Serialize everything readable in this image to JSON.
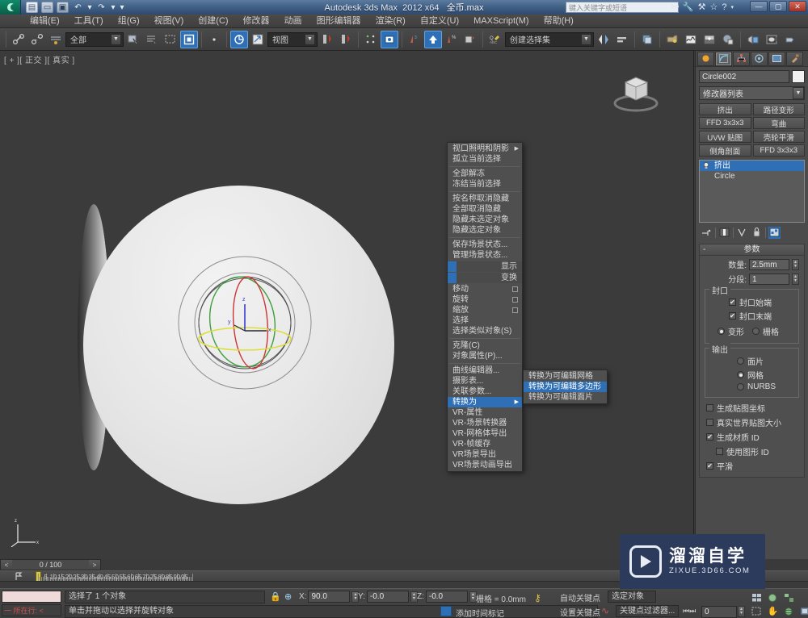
{
  "titlebar": {
    "app_name": "Autodesk 3ds Max",
    "version": "2012 x64",
    "file_name": "全币.max",
    "search_placeholder": "键入关键字或短语",
    "quick_access": [
      "new-icon",
      "open-icon",
      "save-icon",
      "undo-icon",
      "redo-icon",
      "customize-icon"
    ],
    "window_buttons": [
      "minimize",
      "maximize",
      "close"
    ]
  },
  "menubar": {
    "items": [
      {
        "label": "编辑(E)"
      },
      {
        "label": "工具(T)"
      },
      {
        "label": "组(G)"
      },
      {
        "label": "视图(V)"
      },
      {
        "label": "创建(C)"
      },
      {
        "label": "修改器"
      },
      {
        "label": "动画"
      },
      {
        "label": "图形编辑器"
      },
      {
        "label": "渲染(R)"
      },
      {
        "label": "自定义(U)"
      },
      {
        "label": "MAXScript(M)"
      },
      {
        "label": "帮助(H)"
      }
    ]
  },
  "toolbar": {
    "selection_filter": "全部",
    "reference_coord": "视图",
    "named_selection_set": "创建选择集",
    "buttons": [
      "link-icon",
      "unlink-icon",
      "bind-space-warp-icon",
      "select-object-icon",
      "select-by-name-icon",
      "select-region-icon",
      "window-crossing-icon",
      "select-and-move-icon",
      "select-and-rotate-icon",
      "select-and-scale-icon",
      "mirror-icon",
      "align-icon",
      "layers-icon",
      "curve-editor-icon",
      "schematic-view-icon",
      "material-editor-icon",
      "render-setup-icon",
      "rendered-frame-icon",
      "render-production-icon"
    ]
  },
  "viewport": {
    "label": "[ + ][ 正交 ][ 真实 ]",
    "axis_labels": {
      "x": "x",
      "y": "y",
      "z": "z"
    },
    "gizmo_colors": {
      "x_axis": "#cc3333",
      "y_axis": "#33aa33",
      "z_axis": "#dddd33",
      "screen": "#8d8d8d"
    },
    "object_color": "#e7e7e7"
  },
  "context_menu": {
    "items": [
      {
        "label": "视口照明和阴影",
        "submenu": true
      },
      {
        "label": "孤立当前选择"
      },
      {
        "divider_after": true
      },
      {
        "label": "全部解冻"
      },
      {
        "label": "冻结当前选择"
      },
      {
        "divider_after": true
      },
      {
        "label": "按名称取消隐藏"
      },
      {
        "label": "全部取消隐藏"
      },
      {
        "label": "隐藏未选定对象"
      },
      {
        "label": "隐藏选定对象"
      },
      {
        "divider_after": true
      },
      {
        "label": "保存场景状态..."
      },
      {
        "label": "管理场景状态..."
      }
    ],
    "right_rows": [
      {
        "label": "显示"
      },
      {
        "label": "变换"
      }
    ],
    "transform_items": [
      {
        "label": "移动",
        "settings_box": true
      },
      {
        "label": "旋转",
        "settings_box": true
      },
      {
        "label": "缩放",
        "settings_box": true
      },
      {
        "label": "选择"
      },
      {
        "label": "选择类似对象(S)"
      }
    ],
    "object_items": [
      {
        "label": "克隆(C)"
      },
      {
        "label": "对象属性(P)..."
      }
    ],
    "editor_items": [
      {
        "label": "曲线编辑器..."
      },
      {
        "label": "摄影表..."
      },
      {
        "label": "关联参数..."
      }
    ],
    "convert_item": {
      "label": "转换为",
      "submenu": true,
      "highlighted": true
    },
    "vray_items": [
      {
        "label": "VR-属性"
      },
      {
        "label": "VR-场景转换器"
      },
      {
        "label": "VR-网格体导出"
      },
      {
        "label": "VR-帧缓存"
      },
      {
        "label": "VR场景导出"
      },
      {
        "label": "VR场景动画导出"
      }
    ]
  },
  "submenu": {
    "items": [
      {
        "label": "转换为可编辑网格",
        "selected": false
      },
      {
        "label": "转换为可编辑多边形",
        "selected": true
      },
      {
        "label": "转换为可编辑面片",
        "selected": false
      }
    ]
  },
  "command_panel": {
    "tabs": [
      "create-tab",
      "modify-tab",
      "hierarchy-tab",
      "motion-tab",
      "display-tab",
      "utilities-tab"
    ],
    "active_tab_index": 1,
    "object_name": "Circle002",
    "modifier_list_label": "修改器列表",
    "modifier_buttons": [
      "挤出",
      "路径变形",
      "FFD 3x3x3",
      "弯曲",
      "UVW 贴图",
      "壳轮平滑",
      "侧角剖面",
      "FFD 3x3x3"
    ],
    "stack": [
      {
        "label": "挤出",
        "selected": true
      },
      {
        "label": "Circle",
        "selected": false
      }
    ],
    "stack_tools": [
      "pin-stack-icon",
      "show-end-result-icon",
      "make-unique-icon",
      "remove-modifier-icon",
      "configure-sets-icon"
    ],
    "parameters": {
      "title": "参数",
      "amount_label": "数量:",
      "amount_value": "2.5mm",
      "segments_label": "分段:",
      "segments_value": "1",
      "capping": {
        "group_label": "封口",
        "cap_start_label": "封口始端",
        "cap_start_checked": true,
        "cap_end_label": "封口末端",
        "cap_end_checked": true,
        "morph_label": "变形",
        "morph_selected": true,
        "grid_label": "栅格",
        "grid_selected": false
      },
      "output": {
        "group_label": "输出",
        "options": [
          {
            "label": "面片",
            "selected": false
          },
          {
            "label": "网格",
            "selected": true
          },
          {
            "label": "NURBS",
            "selected": false
          }
        ]
      },
      "gen_map_coords_label": "生成贴图坐标",
      "gen_map_coords_checked": false,
      "real_world_label": "真实世界贴图大小",
      "real_world_checked": false,
      "gen_material_id_label": "生成材质 ID",
      "gen_material_id_checked": true,
      "use_shape_id_label": "使用图形 ID",
      "use_shape_id_checked": false,
      "smooth_label": "平滑",
      "smooth_checked": true
    }
  },
  "timebar": {
    "current_frame_display": "0 / 100",
    "prev_label": "<",
    "next_label": ">",
    "tick_labels": [
      "5",
      "10",
      "15",
      "20",
      "25",
      "30",
      "35",
      "40",
      "45",
      "50",
      "55",
      "60",
      "65",
      "70",
      "75",
      "80",
      "85",
      "90",
      "95"
    ],
    "slider_frame": 0
  },
  "status": {
    "row_label": "所在行:",
    "row_prefix": "一",
    "selection_text": "选择了 1 个对象",
    "prompt_text": "单击并拖动以选择并旋转对象",
    "lock_icon": "lock-selection-icon",
    "coordinate_icon": "absolute-relative-icon",
    "x_label": "X:",
    "x_value": "90.0",
    "y_label": "Y:",
    "y_value": "-0.0",
    "z_label": "Z:",
    "z_value": "-0.0",
    "grid_text": "栅格 = 0.0mm",
    "add_time_tag": "添加时间标记",
    "auto_key": "自动关键点",
    "set_key": "设置关键点",
    "selection_set_field": "选定对象",
    "key_filters": "关键点过滤器...",
    "spinner_value": "0",
    "nav_icons": [
      "zoom-icon",
      "zoom-all-icon",
      "zoom-extents-icon",
      "zoom-region-icon",
      "pan-icon",
      "orbit-icon",
      "maximize-viewport-icon"
    ]
  },
  "watermark": {
    "title": "溜溜自学",
    "url": "ZIXUE.3D66.COM"
  }
}
